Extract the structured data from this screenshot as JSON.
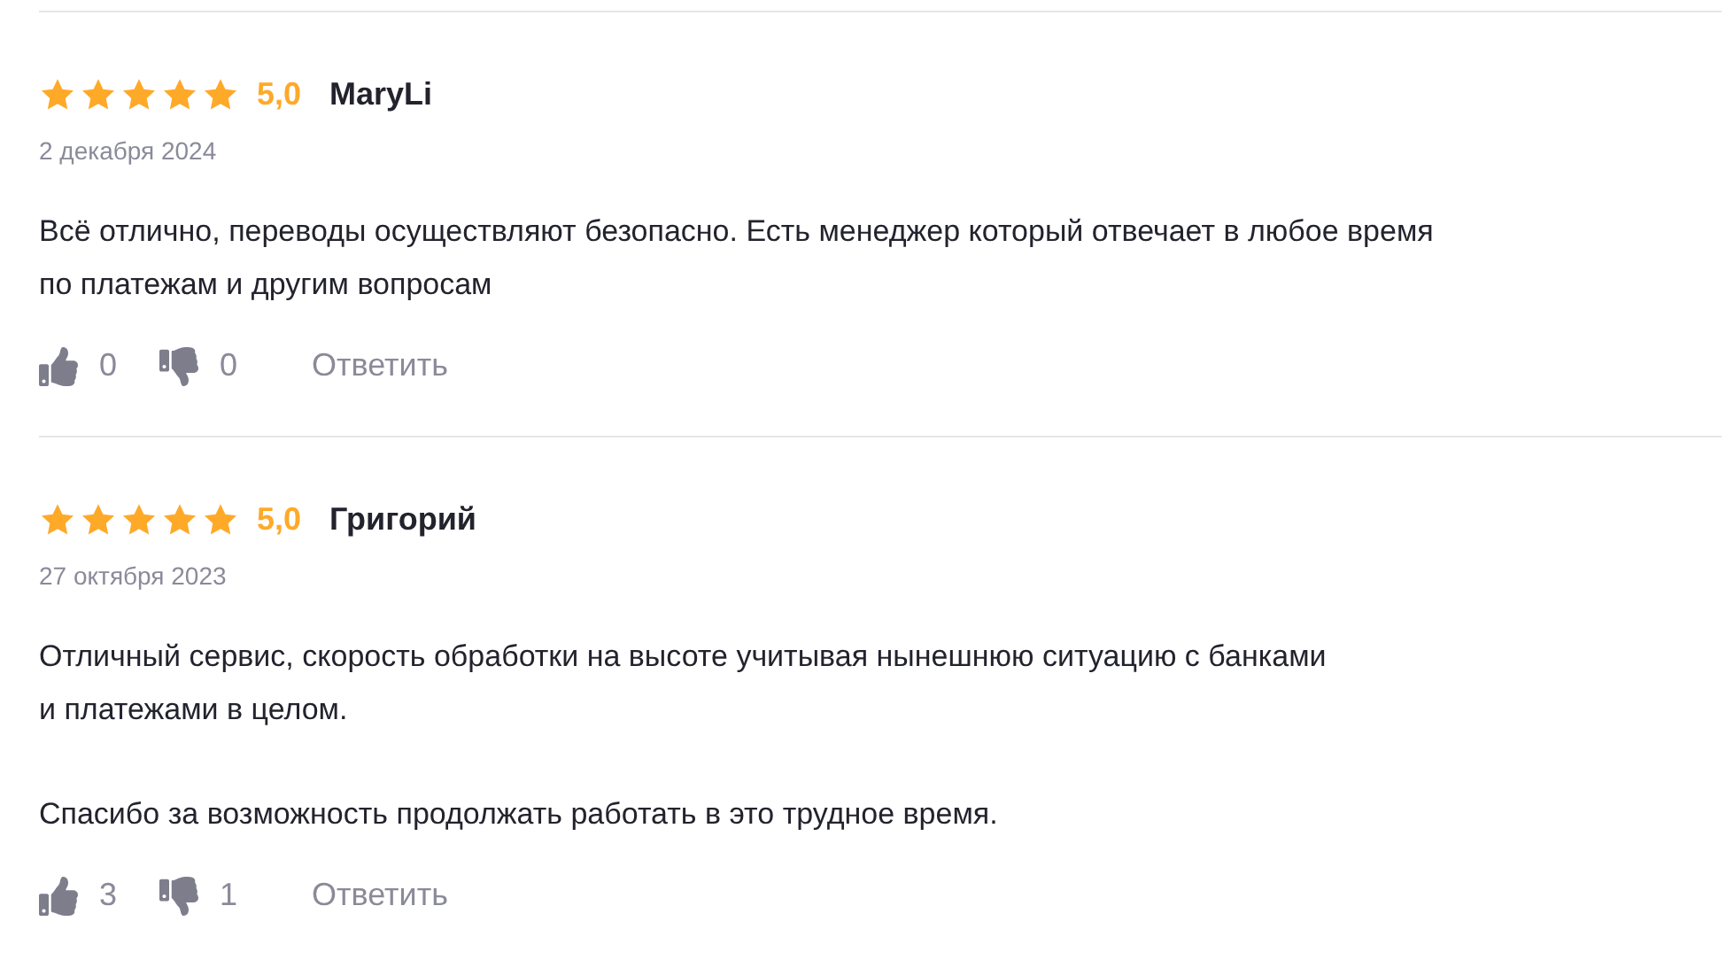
{
  "reviews": [
    {
      "stars": 5,
      "rating": "5,0",
      "author": "MaryLi",
      "date": "2 декабря 2024",
      "paragraphs": [
        "Всё отлично, переводы осуществляют безопасно. Есть менеджер который отвечает в любое время\nпо платежам и другим вопросам"
      ],
      "likes": "0",
      "dislikes": "0",
      "reply": "Ответить"
    },
    {
      "stars": 5,
      "rating": "5,0",
      "author": "Григорий",
      "date": "27 октября 2023",
      "paragraphs": [
        "Отличный сервис, скорость обработки на высоте учитывая нынешнюю ситуацию с банками\nи платежами в целом.",
        "Спасибо за возможность продолжать работать в это трудное время."
      ],
      "likes": "3",
      "dislikes": "1",
      "reply": "Ответить"
    }
  ]
}
